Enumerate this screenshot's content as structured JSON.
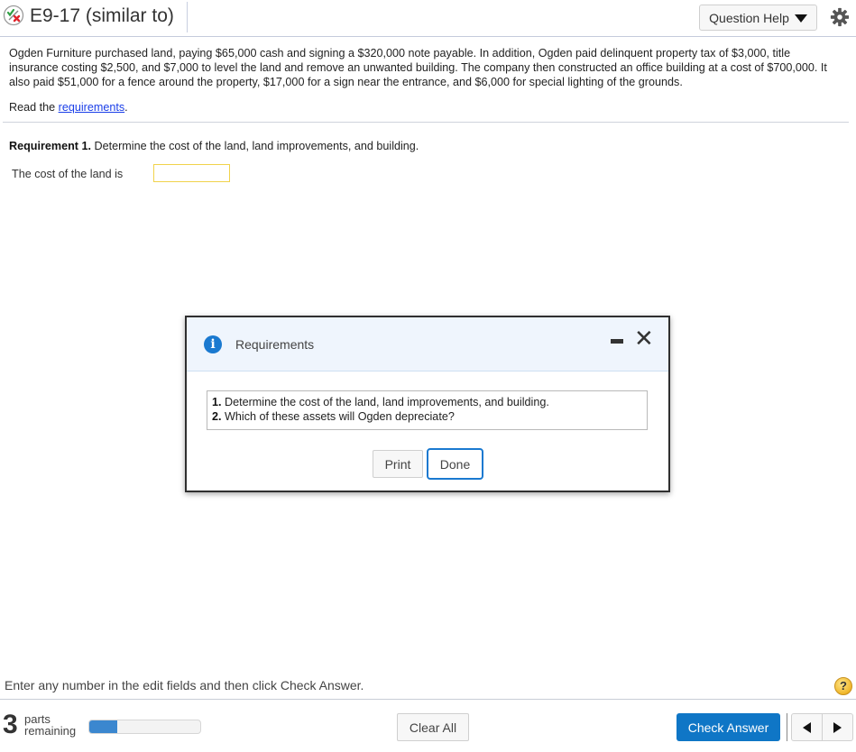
{
  "header": {
    "title": "E9-17 (similar to)",
    "status_icon": "partial-correct-icon",
    "question_help_label": "Question Help",
    "settings_icon": "gear-icon"
  },
  "problem": {
    "text": "Ogden Furniture purchased land, paying $65,000 cash and signing a $320,000 note payable. In addition, Ogden paid delinquent property tax of $3,000, title insurance costing $2,500, and $7,000 to level the land and remove an unwanted building. The company then constructed an office building at a cost of $700,000. It also paid $51,000 for a fence around the property, $17,000 for a sign near the entrance, and $6,000 for special lighting of the grounds.",
    "read_prefix": "Read the ",
    "read_link": "requirements",
    "read_suffix": "."
  },
  "requirement1": {
    "label": "Requirement 1.",
    "text": " Determine the cost of the land, land improvements, and building.",
    "land_label": "The cost of the land is",
    "land_value": ""
  },
  "dialog": {
    "title": "Requirements",
    "items": [
      {
        "num": "1.",
        "text": " Determine the cost of the land, land improvements, and building."
      },
      {
        "num": "2.",
        "text": " Which of these assets will Ogden depreciate?"
      }
    ],
    "print_label": "Print",
    "done_label": "Done",
    "close_glyph": "✕"
  },
  "footer": {
    "instruction": "Enter any number in the edit fields and then click Check Answer.",
    "help_glyph": "?",
    "parts_count": "3",
    "parts_word": "parts",
    "remaining_word": "remaining",
    "progress_fraction": 0.25,
    "clear_all_label": "Clear All",
    "check_answer_label": "Check Answer"
  },
  "colors": {
    "accent": "#0f76c6",
    "progress": "#3b87cf",
    "input_border": "#f1d24b",
    "link": "#1a3ee8"
  }
}
